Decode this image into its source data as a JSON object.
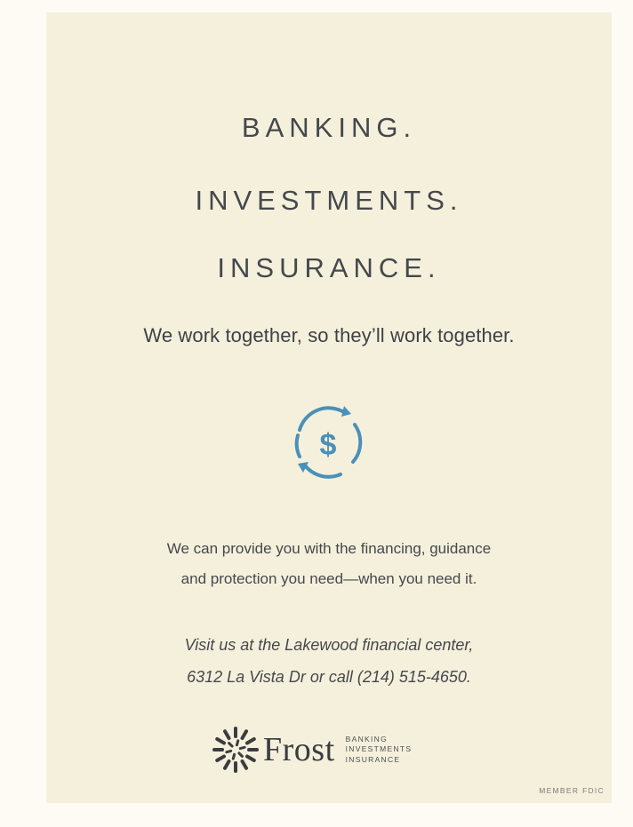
{
  "headline": [
    "BANKING.",
    "INVESTMENTS.",
    "INSURANCE."
  ],
  "tagline": "We work together, so they’ll work together.",
  "icon": "dollar-cycle-icon",
  "body": [
    "We can provide you with the financing, guidance",
    "and protection you need—when you need it."
  ],
  "visit": [
    "Visit us at the Lakewood financial center,",
    "6312 La Vista Dr or call (214) 515-4650."
  ],
  "logo": {
    "name": "Frost",
    "lines": [
      "BANKING",
      "INVESTMENTS",
      "INSURANCE"
    ]
  },
  "fdic": "MEMBER FDIC",
  "colors": {
    "page": "#fdfbf3",
    "panel": "#f5f0dc",
    "text": "#45484c",
    "accent": "#4a90b8"
  }
}
